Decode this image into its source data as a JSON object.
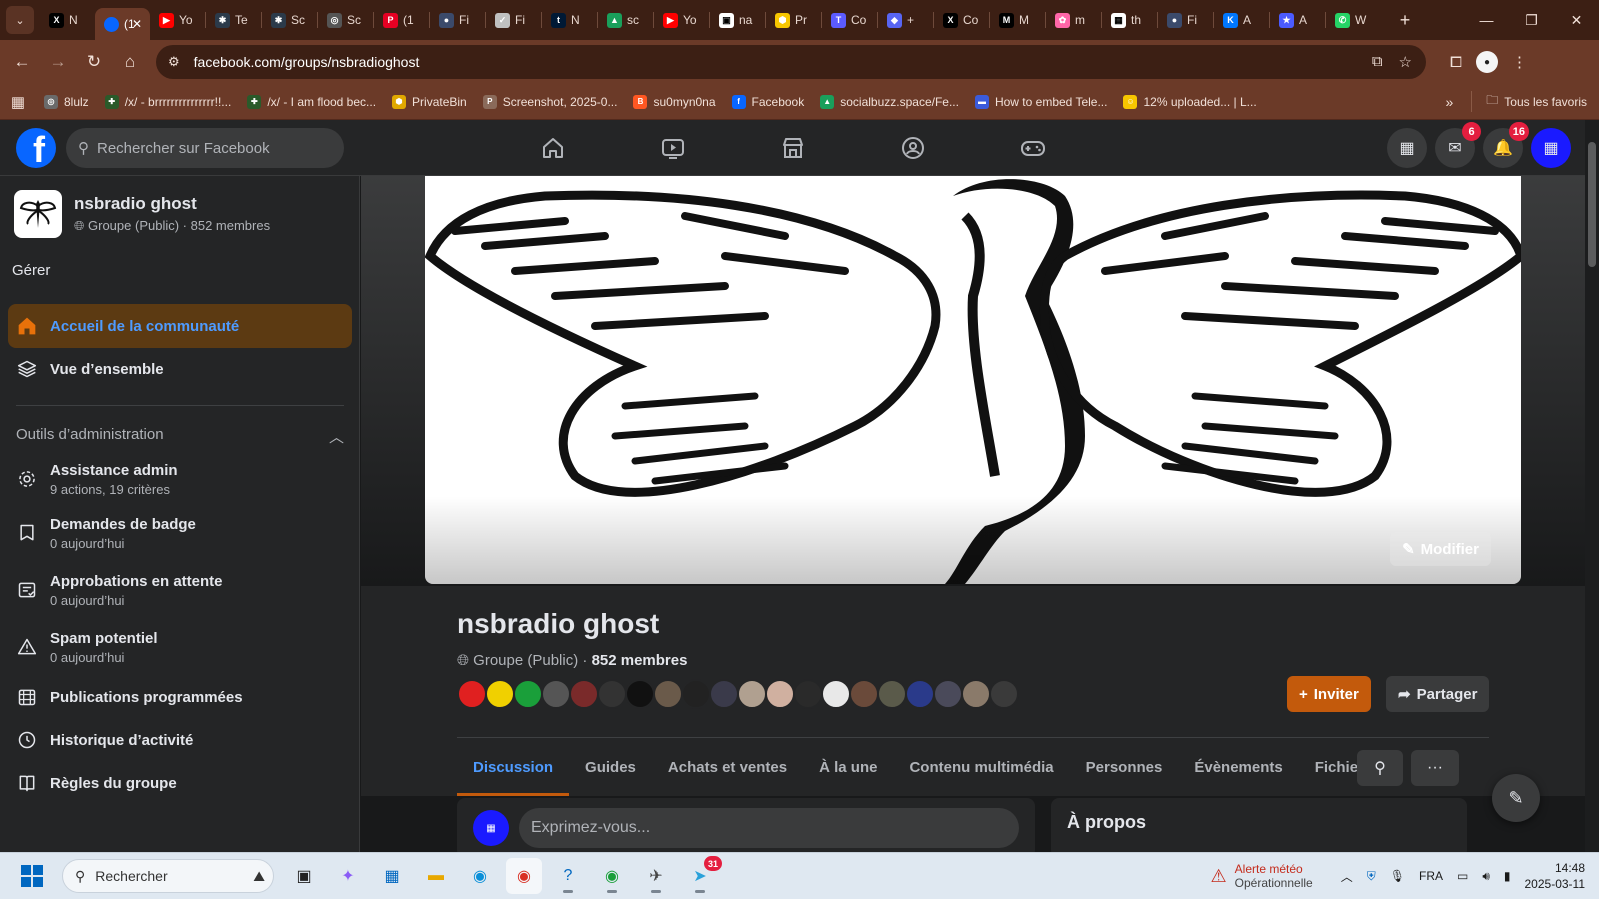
{
  "browser": {
    "tabs": [
      {
        "icon": "x-icon",
        "color": "#000000",
        "glyph": "X",
        "title": "N",
        "active": false
      },
      {
        "icon": "facebook-icon",
        "color": "#0866ff",
        "glyph": "",
        "title": "(1",
        "active": true
      },
      {
        "icon": "youtube-icon",
        "color": "#ff0000",
        "glyph": "▶",
        "title": "Yo",
        "active": false
      },
      {
        "icon": "gear-icon",
        "color": "#2b3a4a",
        "glyph": "✱",
        "title": "Te",
        "active": false
      },
      {
        "icon": "gear-icon",
        "color": "#2b3a4a",
        "glyph": "✱",
        "title": "Sc",
        "active": false
      },
      {
        "icon": "globe-icon",
        "color": "#555555",
        "glyph": "◎",
        "title": "Sc",
        "active": false
      },
      {
        "icon": "pinterest-icon",
        "color": "#e60023",
        "glyph": "P",
        "title": "(1",
        "active": false
      },
      {
        "icon": "avatar-icon",
        "color": "#3b4a6b",
        "glyph": "●",
        "title": "Fi",
        "active": false
      },
      {
        "icon": "nike-icon",
        "color": "#c0c0c0",
        "glyph": "✓",
        "title": "Fi",
        "active": false
      },
      {
        "icon": "tumblr-icon",
        "color": "#001935",
        "glyph": "t",
        "title": "N",
        "active": false
      },
      {
        "icon": "map-icon",
        "color": "#1a9f5b",
        "glyph": "▲",
        "title": "sc",
        "active": false
      },
      {
        "icon": "youtube-icon",
        "color": "#ff0000",
        "glyph": "▶",
        "title": "Yo",
        "active": false
      },
      {
        "icon": "image-icon",
        "color": "#ffffff",
        "glyph": "▣",
        "title": "na",
        "active": false
      },
      {
        "icon": "hexagon-icon",
        "color": "#f7c600",
        "glyph": "⬢",
        "title": "Pr",
        "active": false
      },
      {
        "icon": "t-icon",
        "color": "#5b5bff",
        "glyph": "T",
        "title": "Co",
        "active": false
      },
      {
        "icon": "discord-icon",
        "color": "#5865f2",
        "glyph": "◆",
        "title": "+",
        "active": false
      },
      {
        "icon": "x-icon",
        "color": "#000000",
        "glyph": "X",
        "title": "Co",
        "active": false
      },
      {
        "icon": "medium-icon",
        "color": "#000000",
        "glyph": "M",
        "title": "M",
        "active": false
      },
      {
        "icon": "pink-icon",
        "color": "#ff66a8",
        "glyph": "✿",
        "title": "m",
        "active": false
      },
      {
        "icon": "grid-icon",
        "color": "#ffffff",
        "glyph": "▦",
        "title": "th",
        "active": false
      },
      {
        "icon": "avatar-icon",
        "color": "#3b4a6b",
        "glyph": "●",
        "title": "Fi",
        "active": false
      },
      {
        "icon": "vk-icon",
        "color": "#0077ff",
        "glyph": "K",
        "title": "A",
        "active": false
      },
      {
        "icon": "star-icon",
        "color": "#4b5bff",
        "glyph": "★",
        "title": "A",
        "active": false
      },
      {
        "icon": "whatsapp-icon",
        "color": "#25d366",
        "glyph": "✆",
        "title": "W",
        "active": false
      }
    ],
    "new_tab": "+",
    "url": "facebook.com/groups/nsbradioghost"
  },
  "bookmarks": [
    {
      "label": "8lulz",
      "color": "#6a6a6a",
      "glyph": "◎"
    },
    {
      "label": "/x/ - brrrrrrrrrrrrrrr!!...",
      "color": "#2a5a2a",
      "glyph": "✚"
    },
    {
      "label": "/x/ - I am flood bec...",
      "color": "#2a5a2a",
      "glyph": "✚"
    },
    {
      "label": "PrivateBin",
      "color": "#e0a800",
      "glyph": "⬢"
    },
    {
      "label": "Screenshot, 2025-0...",
      "color": "#8a6a5a",
      "glyph": "P"
    },
    {
      "label": "su0myn0na",
      "color": "#ff5722",
      "glyph": "B"
    },
    {
      "label": "Facebook",
      "color": "#0866ff",
      "glyph": "f"
    },
    {
      "label": "socialbuzz.space/Fe...",
      "color": "#1a9f5b",
      "glyph": "▲"
    },
    {
      "label": "How to embed Tele...",
      "color": "#3b5bdb",
      "glyph": "▬"
    },
    {
      "label": "12% uploaded... | L...",
      "color": "#f7c600",
      "glyph": "☺"
    }
  ],
  "bookmarks_more": "»",
  "bookmarks_all": "Tous les favoris",
  "fb": {
    "search_placeholder": "Rechercher sur Facebook",
    "messenger_badge": "6",
    "notifications_badge": "16"
  },
  "sidebar": {
    "group_name": "nsbradio ghost",
    "group_meta": "Groupe (Public) · 852 membres",
    "manage": "Gérer",
    "items": [
      {
        "label": "Accueil de la communauté"
      },
      {
        "label": "Vue d’ensemble"
      }
    ],
    "admin_tools": "Outils d’administration",
    "tools": [
      {
        "label": "Assistance admin",
        "sub": "9 actions, 19 critères"
      },
      {
        "label": "Demandes de badge",
        "sub": "0 aujourd’hui"
      },
      {
        "label": "Approbations en attente",
        "sub": "0 aujourd’hui"
      },
      {
        "label": "Spam potentiel",
        "sub": "0 aujourd’hui"
      },
      {
        "label": "Publications programmées",
        "sub": ""
      },
      {
        "label": "Historique d’activité",
        "sub": ""
      },
      {
        "label": "Règles du groupe",
        "sub": ""
      }
    ]
  },
  "group": {
    "edit_cover": "Modifier",
    "title": "nsbradio ghost",
    "privacy": "Groupe (Public)",
    "members": "852 membres",
    "invite": "Inviter",
    "share": "Partager",
    "tabs": [
      "Discussion",
      "Guides",
      "Achats et ventes",
      "À la une",
      "Contenu multimédia",
      "Personnes",
      "Évènements",
      "Fichiers"
    ],
    "composer_placeholder": "Exprimez-vous...",
    "about_title": "À propos",
    "member_avatar_colors": [
      "#e02020",
      "#f0d000",
      "#1a9f3a",
      "#555555",
      "#7a2a2a",
      "#333333",
      "#111111",
      "#6a5a4a",
      "#222222",
      "#3a3a4a",
      "#b0a090",
      "#d0b0a0",
      "#2a2a2a",
      "#e8e8e8",
      "#6a4a3a",
      "#5a5a4a",
      "#2a3a8a",
      "#4a4a5a",
      "#8a7a6a",
      "#3a3a3a"
    ]
  },
  "taskbar": {
    "search": "Rechercher",
    "weather_title": "Alerte météo",
    "weather_sub": "Opérationnelle",
    "lang": "FRA",
    "time": "14:48",
    "date": "2025-03-11",
    "telegram_badge": "31"
  }
}
